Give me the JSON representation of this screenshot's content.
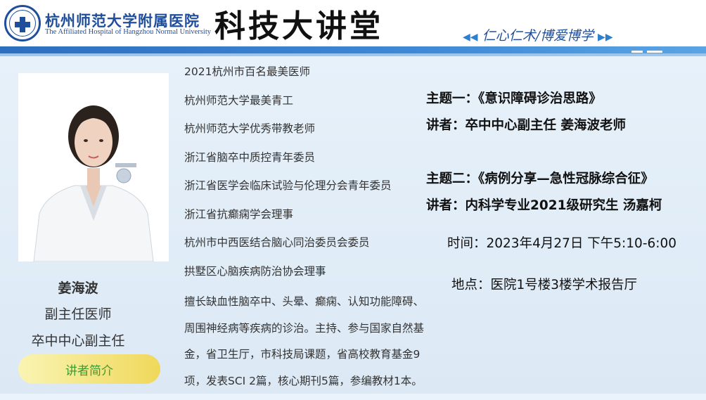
{
  "header": {
    "hospital_cn": "杭州师范大学附属医院",
    "hospital_en": "The Affiliated Hospital of Hangzhou Normal University",
    "main_title": "科技大讲堂",
    "slogan": "仁心仁术/博爱博学",
    "slogan_arrow_left": "◀◀",
    "slogan_arrow_right": "▶▶"
  },
  "speaker": {
    "name": "姜海波",
    "title1": "副主任医师",
    "title2": "卒中中心副主任",
    "intro_button": "讲者简介",
    "honors": [
      "2021杭州市百名最美医师",
      "杭州师范大学最美青工",
      "杭州师范大学优秀带教老师",
      "浙江省脑卒中质控青年委员",
      "浙江省医学会临床试验与伦理分会青年委员",
      "浙江省抗癫痫学会理事",
      "杭州市中西医结合脑心同治委员会委员",
      "拱墅区心脑疾病防治协会理事"
    ],
    "description_lines": [
      "擅长缺血性脑卒中、头晕、癫痫、认知功能障碍、",
      "周围神经病等疾病的诊治。主持、参与国家自然基",
      "金，省卫生厅，市科技局课题，省高校教育基金9",
      "项，发表SCI 2篇，核心期刊5篇，参编教材1本。"
    ]
  },
  "lecture": {
    "topic1": "主题一：《意识障碍诊治思路》",
    "speaker1": "讲者：卒中中心副主任    姜海波老师",
    "topic2": "主题二：《病例分享—急性冠脉综合征》",
    "speaker2": "讲者：内科学专业2021级研究生    汤嘉柯",
    "time": "时间：2023年4月27日 下午5:10-6:00",
    "location": "地点：医院1号楼3楼学术报告厅"
  },
  "colors": {
    "brand_blue": "#1f4e9c",
    "band_blue": "#3f89d6",
    "button_yellow": "#f0d85a",
    "button_text_green": "#3e9b33"
  },
  "icons": {
    "logo": "hospital-cross-logo-icon"
  }
}
